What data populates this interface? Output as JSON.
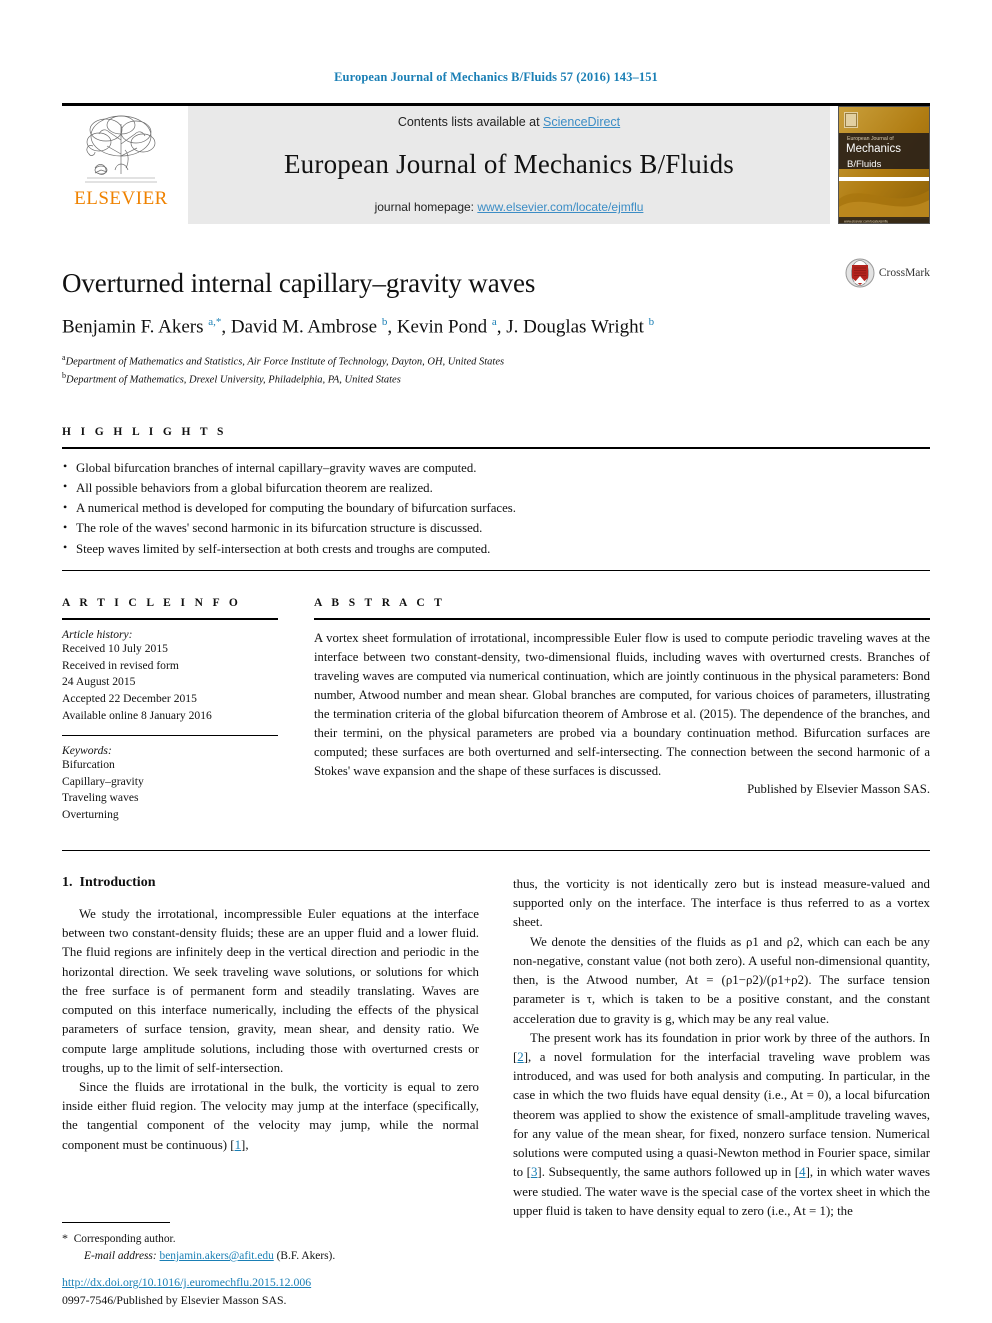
{
  "running_head": "European Journal of Mechanics B/Fluids 57 (2016) 143–151",
  "masthead": {
    "publisher_name": "ELSEVIER",
    "contents_prefix": "Contents lists available at ",
    "contents_link": "ScienceDirect",
    "journal_title": "European Journal of Mechanics B/Fluids",
    "homepage_prefix": "journal homepage: ",
    "homepage_url": "www.elsevier.com/locate/ejmflu",
    "cover": {
      "line1": "European Journal of",
      "line2": "Mechanics",
      "line3": "B/Fluids",
      "footer": "www.elsevier.com/locate/ejmflu"
    }
  },
  "article": {
    "title": "Overturned internal capillary–gravity waves",
    "authors_html": "Benjamin F. Akers <sup>a,*</sup>, David M. Ambrose <sup>b</sup>, Kevin Pond <sup>a</sup>, J. Douglas Wright <sup>b</sup>",
    "affiliations": [
      {
        "marker": "a",
        "text": "Department of Mathematics and Statistics, Air Force Institute of Technology, Dayton, OH, United States"
      },
      {
        "marker": "b",
        "text": "Department of Mathematics, Drexel University, Philadelphia, PA, United States"
      }
    ],
    "crossmark_label": "CrossMark"
  },
  "highlights": {
    "heading": "H I G H L I G H T S",
    "items": [
      "Global bifurcation branches of internal capillary–gravity waves are computed.",
      "All possible behaviors from a global bifurcation theorem are realized.",
      "A numerical method is developed for computing the boundary of bifurcation surfaces.",
      "The role of the waves' second harmonic in its bifurcation structure is discussed.",
      "Steep waves limited by self-intersection at both crests and troughs are computed."
    ]
  },
  "article_info": {
    "heading": "A R T I C L E    I N F O",
    "history_label": "Article history:",
    "history_lines": [
      "Received 10 July 2015",
      "Received in revised form",
      "24 August 2015",
      "Accepted 22 December 2015",
      "Available online 8 January 2016"
    ],
    "keywords_label": "Keywords:",
    "keywords": [
      "Bifurcation",
      "Capillary–gravity",
      "Traveling waves",
      "Overturning"
    ]
  },
  "abstract": {
    "heading": "A B S T R A C T",
    "text": "A vortex sheet formulation of irrotational, incompressible Euler flow is used to compute periodic traveling waves at the interface between two constant-density, two-dimensional fluids, including waves with overturned crests. Branches of traveling waves are computed via numerical continuation, which are jointly continuous in the physical parameters: Bond number, Atwood number and mean shear. Global branches are computed, for various choices of parameters, illustrating the termination criteria of the global bifurcation theorem of Ambrose et al. (2015). The dependence of the branches, and their termini, on the physical parameters are probed via a boundary continuation method. Bifurcation surfaces are computed; these surfaces are both overturned and self-intersecting. The connection between the second harmonic of a Stokes' wave expansion and the shape of these surfaces is discussed.",
    "publisher_line": "Published by Elsevier Masson SAS."
  },
  "body": {
    "section_number": "1.",
    "section_title": "Introduction",
    "left_paragraphs": [
      "We study the irrotational, incompressible Euler equations at the interface between two constant-density fluids; these are an upper fluid and a lower fluid. The fluid regions are infinitely deep in the vertical direction and periodic in the horizontal direction. We seek traveling wave solutions, or solutions for which the free surface is of permanent form and steadily translating. Waves are computed on this interface numerically, including the effects of the physical parameters of surface tension, gravity, mean shear, and density ratio. We compute large amplitude solutions, including those with overturned crests or troughs, up to the limit of self-intersection."
    ],
    "left_para2_pre": "Since the fluids are irrotational in the bulk, the vorticity is equal to zero inside either fluid region. The velocity may jump at the interface (specifically, the tangential component of the velocity may jump, while the normal component must be continuous) [",
    "left_para2_ref": "1",
    "left_para2_post": "],",
    "right_para1": "thus, the vorticity is not identically zero but is instead measure-valued and supported only on the interface. The interface is thus referred to as a vortex sheet.",
    "right_para2": "We denote the densities of the fluids as ρ1 and ρ2, which can each be any non-negative, constant value (not both zero). A useful non-dimensional quantity, then, is the Atwood number, At = (ρ1−ρ2)/(ρ1+ρ2). The surface tension parameter is τ, which is taken to be a positive constant, and the constant acceleration due to gravity is g, which may be any real value.",
    "right_para3_seg1": "The present work has its foundation in prior work by three of the authors. In [",
    "right_para3_ref1": "2",
    "right_para3_seg2": "], a novel formulation for the interfacial traveling wave problem was introduced, and was used for both analysis and computing. In particular, in the case in which the two fluids have equal density (i.e., At = 0), a local bifurcation theorem was applied to show the existence of small-amplitude traveling waves, for any value of the mean shear, for fixed, nonzero surface tension. Numerical solutions were computed using a quasi-Newton method in Fourier space, similar to [",
    "right_para3_ref2": "3",
    "right_para3_seg3": "]. Subsequently, the same authors followed up in [",
    "right_para3_ref3": "4",
    "right_para3_seg4": "], in which water waves were studied. The water wave is the special case of the vortex sheet in which the upper fluid is taken to have density equal to zero (i.e., At = 1); the"
  },
  "footer": {
    "corresponding_marker": "*",
    "corresponding_text": "Corresponding author.",
    "email_label": "E-mail address:",
    "email": "benjamin.akers@afit.edu",
    "email_suffix": "(B.F. Akers).",
    "doi_url": "http://dx.doi.org/10.1016/j.euromechflu.2015.12.006",
    "issn_line": "0997-7546/Published by Elsevier Masson SAS."
  },
  "colors": {
    "link_blue": "#1a7fb5",
    "sciencedirect_blue": "#3c8dc5",
    "elsevier_orange": "#ef8200",
    "banner_grey": "#e9e9e9"
  }
}
